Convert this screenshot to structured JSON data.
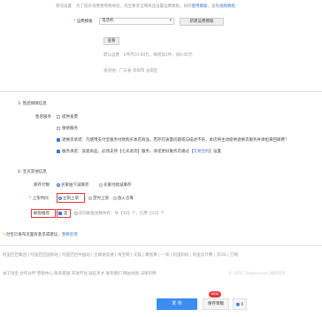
{
  "logistics": {
    "intro_label": "物流设置",
    "intro_text": "为了提升消费者购物体验，淘宝要求全网商品设置运费模板，如何",
    "intro_link1": "使用模板",
    "intro_text2": "，查看",
    "intro_link2": "视频教程",
    "template_label": "运费模板",
    "template_value": "电话机",
    "new_template_button": "新建运费模板",
    "select_button": "查看",
    "default_text": "默认运费：1件内10.00元，每增加1件，加0.00元",
    "ship_from": "发货地：广东省 深圳市 龙岗区"
  },
  "after_sales": {
    "section_title": "3. 售后保障信息",
    "label": "售后服务",
    "option_invoice": "提供发票",
    "option_warranty": "保修服务",
    "return_text": "退换货承诺：凡使用支付宝服务付款购买本店商品，若存在质量问题或与描述不符，本店将主动提供退换货服务并承担来回邮费！",
    "service_text": "服务承诺：该类商品，必须支持【七天退货】服务，承诺更好服务可通过【",
    "service_link": "交易合约",
    "service_text2": "】设置"
  },
  "other": {
    "section_title": "4. 宝贝其他信息",
    "stock_label": "库存计数",
    "stock_opt1": "买家拍下减库存",
    "stock_opt2": "买家付款减库存",
    "listing_label": "上架时间",
    "listing_opt1": "立刻上架",
    "listing_opt2": "定时上架",
    "listing_opt3": "放入仓库",
    "recommend_label": "橱窗推荐",
    "recommend_opt": "是",
    "recommend_note": "您的橱窗总数共有：共【30】个，已用【33】个"
  },
  "feedback": {
    "text": "对宝贝发布页面有意见或建议，",
    "link": "我要反馈"
  },
  "footer": {
    "links_row1": "阿里巴巴集团 | 阿里巴巴国际站 | 阿里巴巴中国站 | 全球速卖通 | 淘宝网 | 天猫 | 聚划算 | 一淘 | 阿里妈妈 | 阿里云计算 | 云OS | 万网",
    "links_row2": "关于淘宝  合作伙伴  营销中心  联系客服  开放平台  诚征英才  联系我们  网站地图  法律声明",
    "copyright": "© 2015 Taobao.com 版权所有"
  },
  "actions": {
    "publish": "发 布",
    "save_draft": "保存草稿",
    "draft_count": "0",
    "new_badge": "NEW"
  }
}
